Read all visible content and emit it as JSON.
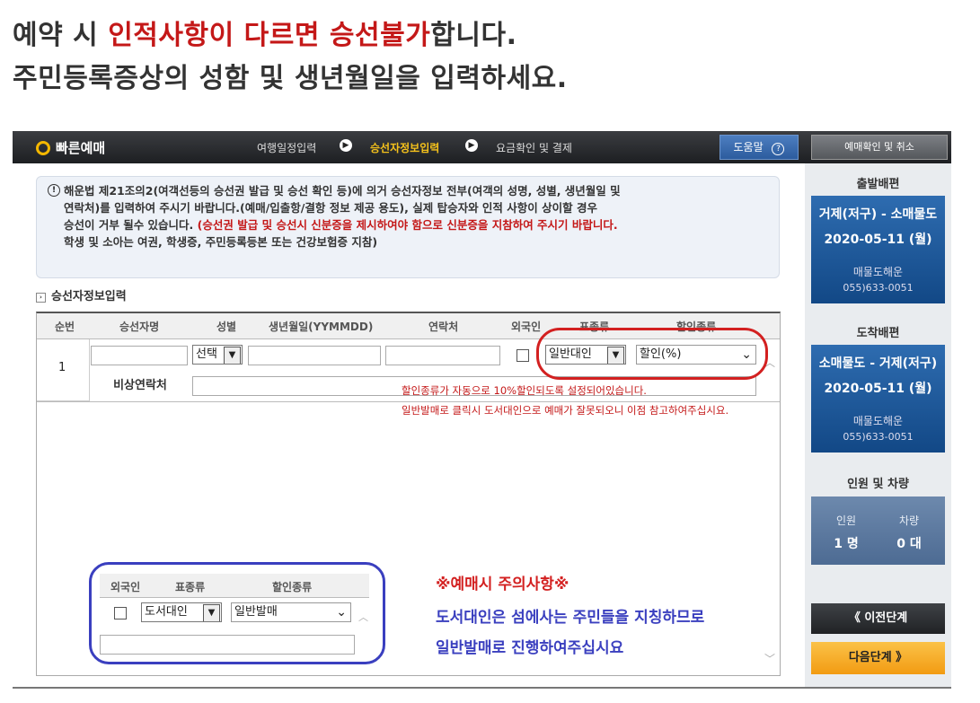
{
  "headline": {
    "line1_pre": "예약 시 ",
    "line1_red": "인적사항이 다르면 승선불가",
    "line1_post": "합니다.",
    "line2": "주민등록증상의 성함 및 생년월일을 입력하세요."
  },
  "topbar": {
    "brand": "빠른예매",
    "steps": [
      "여행일정입력",
      "승선자정보입력",
      "요금확인 및 결제"
    ],
    "help": "도움말",
    "confirm": "예매확인 및 취소"
  },
  "notice": {
    "lines": [
      "해운법 제21조의2(여객선등의 승선권 발급 및 승선 확인 등)에 의거 승선자정보 전부(여객의 성명, 성별, 생년월일 및",
      "연락처)를 입력하여 주시기 바랍니다.(예매/입출항/결항 정보 제공 용도), 실제 탑승자와 인적 사항이 상이할 경우",
      "승선이 거부 될수 있습니다."
    ],
    "line3_red": "(승선권 발급 및 승선시 신분증을 제시하여야 함으로 신분증을 지참하여 주시기 바랍니다.",
    "line4_red": "학생 및 소아는 여권, 학생증, 주민등록등본 또는 건강보험증 지참)"
  },
  "section_title": "승선자정보입력",
  "table": {
    "headers": [
      "순번",
      "승선자명",
      "성별",
      "생년월일(YYMMDD)",
      "연락처",
      "외국인",
      "표종류",
      "할인종류"
    ],
    "row_no": "1",
    "gender_select": "선택",
    "ticket_type": "일반대인",
    "discount_type": "할인(%)",
    "emergency_label": "비상연락처",
    "warn1": "할인종류가 자동으로 10%할인되도록 설정되어있습니다.",
    "warn2": "일반발매로 클릭시 도서대인으로 예매가 잘못되오니 이점 참고하여주십시요."
  },
  "example": {
    "headers": [
      "외국인",
      "표종류",
      "할인종류"
    ],
    "ticket_type": "도서대인",
    "discount_type": "일반발매"
  },
  "caution": {
    "title": "※예매시 주의사항※",
    "line1": "도서대인은 섬에사는 주민들을 지칭하므로",
    "line2": "일반발매로 진행하여주십시요"
  },
  "sidebar": {
    "departure_title": "출발배편",
    "departure": {
      "route": "거제(저구) - 소매물도",
      "date": "2020-05-11 (월)",
      "company": "매물도해운",
      "phone": "055)633-0051"
    },
    "arrival_title": "도착배편",
    "arrival": {
      "route": "소매물도 - 거제(저구)",
      "date": "2020-05-11 (월)",
      "company": "매물도해운",
      "phone": "055)633-0051"
    },
    "pax_title": "인원 및 차량",
    "pax_label": "인원",
    "pax_value": "1 명",
    "car_label": "차량",
    "car_value": "0 대",
    "prev": "《  이전단계",
    "next": "다음단계  》"
  },
  "colors": {
    "accent_red": "#c41818",
    "annotation_red": "#d32020",
    "annotation_blue": "#3a3fbf",
    "brand_yellow": "#f6c21b"
  }
}
